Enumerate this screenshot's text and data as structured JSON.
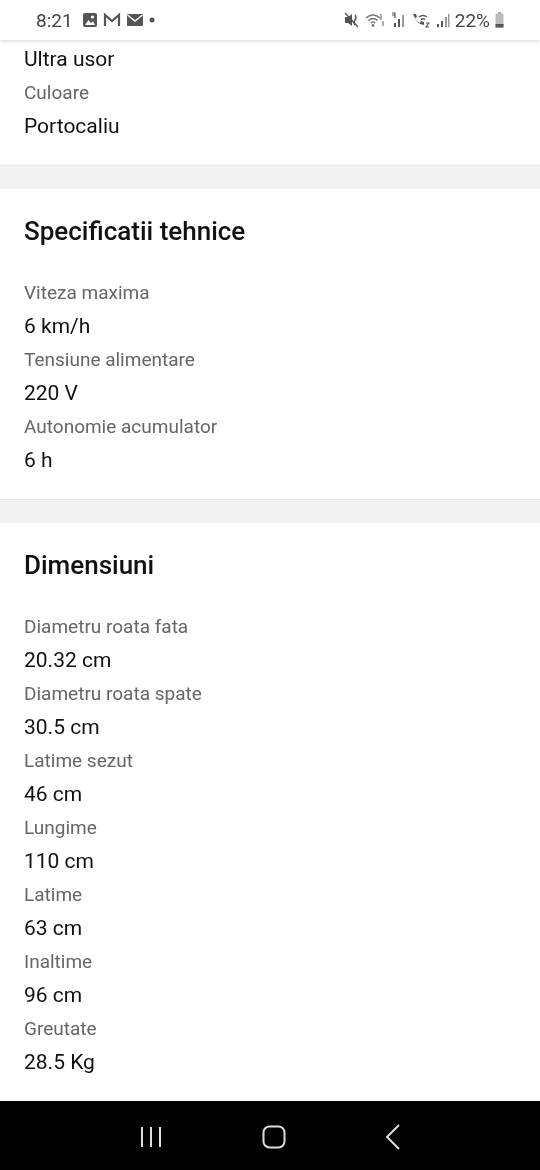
{
  "status_bar": {
    "time": "8:21",
    "battery": "22%"
  },
  "sections": [
    {
      "specs": [
        {
          "value": "Ultra usor"
        },
        {
          "label": "Culoare",
          "value": "Portocaliu"
        }
      ]
    },
    {
      "title": "Specificatii tehnice",
      "specs": [
        {
          "label": "Viteza maxima",
          "value": "6 km/h"
        },
        {
          "label": "Tensiune alimentare",
          "value": "220 V"
        },
        {
          "label": "Autonomie acumulator",
          "value": "6 h"
        }
      ]
    },
    {
      "title": "Dimensiuni",
      "specs": [
        {
          "label": "Diametru roata fata",
          "value": "20.32 cm"
        },
        {
          "label": "Diametru roata spate",
          "value": "30.5 cm"
        },
        {
          "label": "Latime sezut",
          "value": "46 cm"
        },
        {
          "label": "Lungime",
          "value": "110 cm"
        },
        {
          "label": "Latime",
          "value": "63 cm"
        },
        {
          "label": "Inaltime",
          "value": "96 cm"
        },
        {
          "label": "Greutate",
          "value": "28.5 Kg"
        }
      ]
    }
  ]
}
